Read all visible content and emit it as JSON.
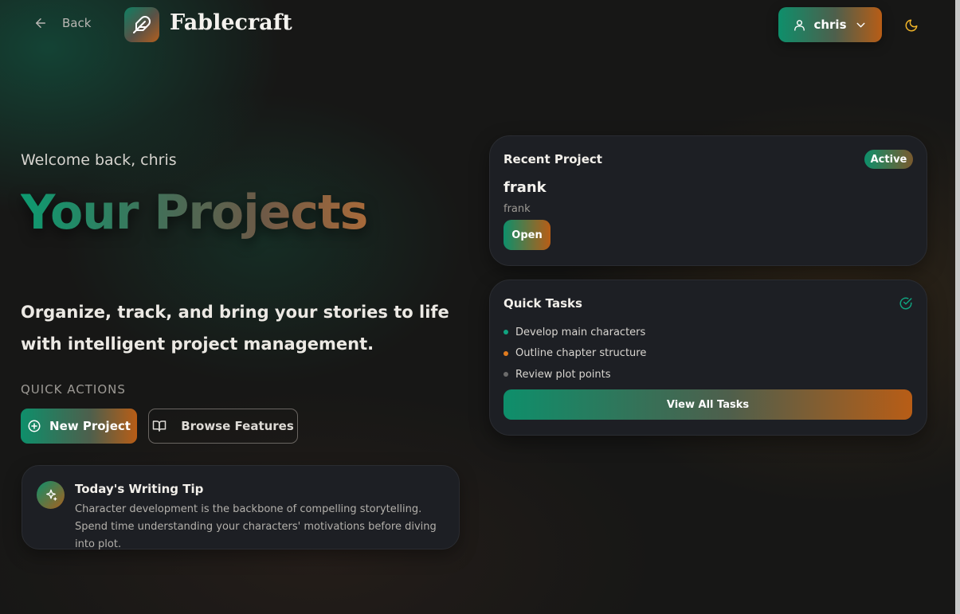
{
  "header": {
    "back_label": "Back",
    "brand": "Fablecraft",
    "user_name": "chris"
  },
  "hero": {
    "welcome": "Welcome back, chris",
    "title": "Your Projects",
    "subtitle": "Organize, track, and bring your stories to life with intelligent project management.",
    "quick_actions_label": "QUICK ACTIONS",
    "new_project_label": "New Project",
    "browse_features_label": "Browse Features"
  },
  "tip": {
    "title": "Today's Writing Tip",
    "body": "Character development is the backbone of compelling storytelling. Spend time understanding your characters' motivations before diving into plot."
  },
  "recent_project": {
    "heading": "Recent Project",
    "status": "Active",
    "name": "frank",
    "description": "frank",
    "open_label": "Open"
  },
  "quick_tasks": {
    "heading": "Quick Tasks",
    "items": [
      {
        "label": "Develop main characters",
        "color": "#10a37f"
      },
      {
        "label": "Outline chapter structure",
        "color": "#e07b1f"
      },
      {
        "label": "Review plot points",
        "color": "#6b6b6b"
      }
    ],
    "view_all_label": "View All Tasks"
  },
  "icons": {
    "back": "arrow-left-icon",
    "logo": "feather-icon",
    "user": "user-icon",
    "dropdown": "chevron-down-icon",
    "theme": "moon-icon",
    "new_project": "plus-circle-icon",
    "browse": "book-open-icon",
    "tip": "sparkles-icon",
    "tasks": "check-circle-icon"
  },
  "colors": {
    "accent_green": "#0e8f6b",
    "accent_orange": "#b85d16",
    "moon": "#f0b429"
  }
}
